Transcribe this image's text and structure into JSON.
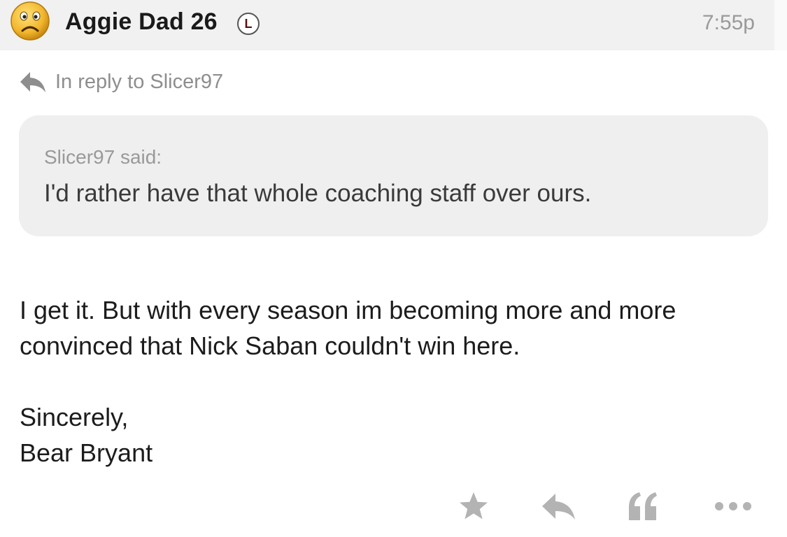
{
  "post": {
    "username": "Aggie Dad 26",
    "badge": "L",
    "timestamp": "7:55p",
    "avatar_icon": "frowning-face-icon",
    "in_reply_to": "In reply to Slicer97",
    "quote": {
      "author_line": "Slicer97 said:",
      "text": "I'd rather have that whole coaching staff over ours."
    },
    "body": {
      "line1": "I get it. But with every season im becoming more and more",
      "line2": "convinced that Nick Saban couldn't win here.",
      "signoff": "Sincerely,",
      "signature": "Bear Bryant"
    }
  },
  "actions": [
    {
      "name": "star",
      "icon": "star-icon"
    },
    {
      "name": "reply",
      "icon": "reply-arrow-icon"
    },
    {
      "name": "quote",
      "icon": "quote-icon"
    },
    {
      "name": "more",
      "icon": "ellipsis-icon"
    }
  ],
  "colors": {
    "header_bg": "#f1f1f1",
    "quote_bg": "#efefef",
    "icon_gray": "#b3b3b3",
    "badge_text": "#5a1010"
  }
}
